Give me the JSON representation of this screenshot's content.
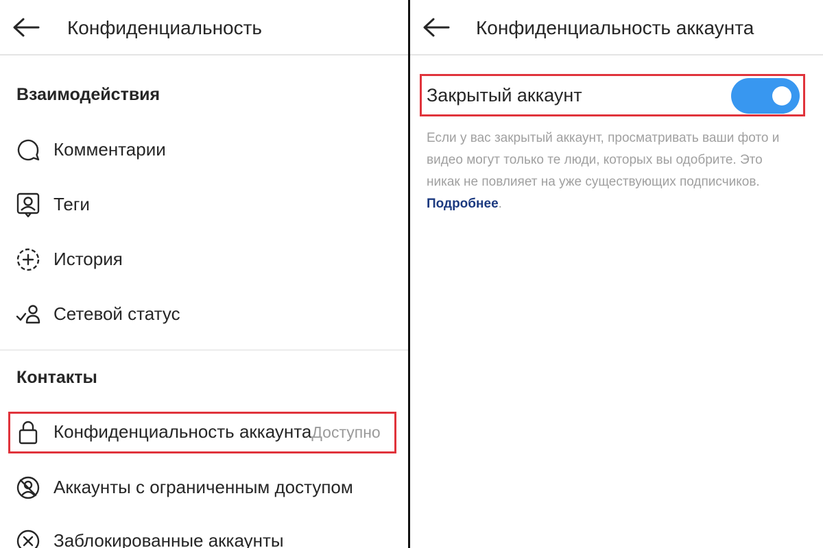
{
  "left_screen": {
    "header": {
      "title": "Конфиденциальность"
    },
    "sections": [
      {
        "title": "Взаимодействия"
      },
      {
        "title": "Контакты"
      }
    ],
    "items": [
      {
        "label": "Комментарии",
        "icon": "comment-icon"
      },
      {
        "label": "Теги",
        "icon": "tag-person-icon"
      },
      {
        "label": "История",
        "icon": "story-add-icon"
      },
      {
        "label": "Сетевой статус",
        "icon": "activity-status-icon"
      },
      {
        "label": "Конфиденциальность аккаунта",
        "value": "Доступно",
        "icon": "lock-icon"
      },
      {
        "label": "Аккаунты с ограниченным доступом",
        "icon": "restricted-icon"
      },
      {
        "label": "Заблокированные аккаунты",
        "icon": "blocked-icon"
      }
    ]
  },
  "right_screen": {
    "header": {
      "title": "Конфиденциальность аккаунта"
    },
    "toggle": {
      "label": "Закрытый аккаунт",
      "state": "on"
    },
    "description": "Если у вас закрытый аккаунт, просматривать ваши фото и видео могут только те люди, которых вы одобрите. Это никак не повлияет на уже существующих подписчиков.",
    "learn_more": "Подробнее",
    "learn_more_suffix": "."
  },
  "colors": {
    "highlight": "#e0333b",
    "toggle_on": "#3897f0",
    "link": "#1c3a80",
    "text": "#262626",
    "muted": "#a0a0a0"
  }
}
